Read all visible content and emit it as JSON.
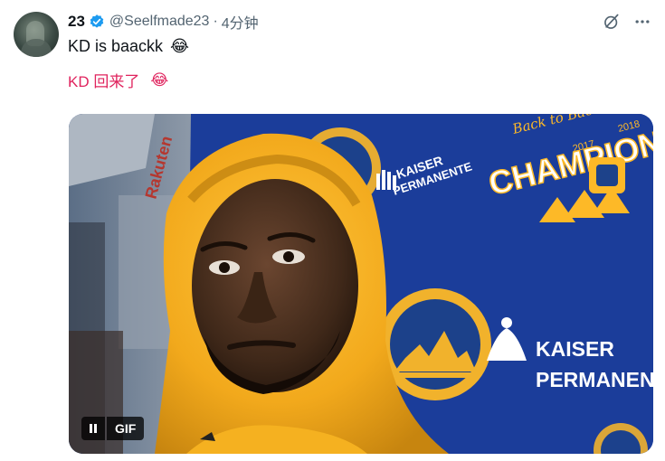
{
  "author": {
    "name": "23",
    "handle": "@Seelfmade23",
    "separator": "·",
    "time": "4分钟"
  },
  "tweet": {
    "text": "KD is baackk",
    "translation": "KD 回来了",
    "emoji": "😂"
  },
  "media": {
    "type_label": "GIF",
    "backdrop": {
      "title_top": "Back to Back",
      "champions": "CHAMPIONS",
      "year_1": "2017",
      "year_2": "2018",
      "sponsor_line1": "KAISER",
      "sponsor_line2": "PERMANENTE",
      "sponsor_small_1": "KAISER",
      "sponsor_small_2": "PERMANENTE",
      "side_text": "Rakuten"
    }
  },
  "colors": {
    "verified_blue": "#1d9bf0",
    "translation_red": "#e0245e",
    "backdrop_blue": "#1b3d9a",
    "hoodie_yellow": "#f5b120",
    "warriors_gold": "#fdb927"
  },
  "icons": [
    "grok-icon",
    "more-icon",
    "verified-badge-icon",
    "pause-icon"
  ]
}
